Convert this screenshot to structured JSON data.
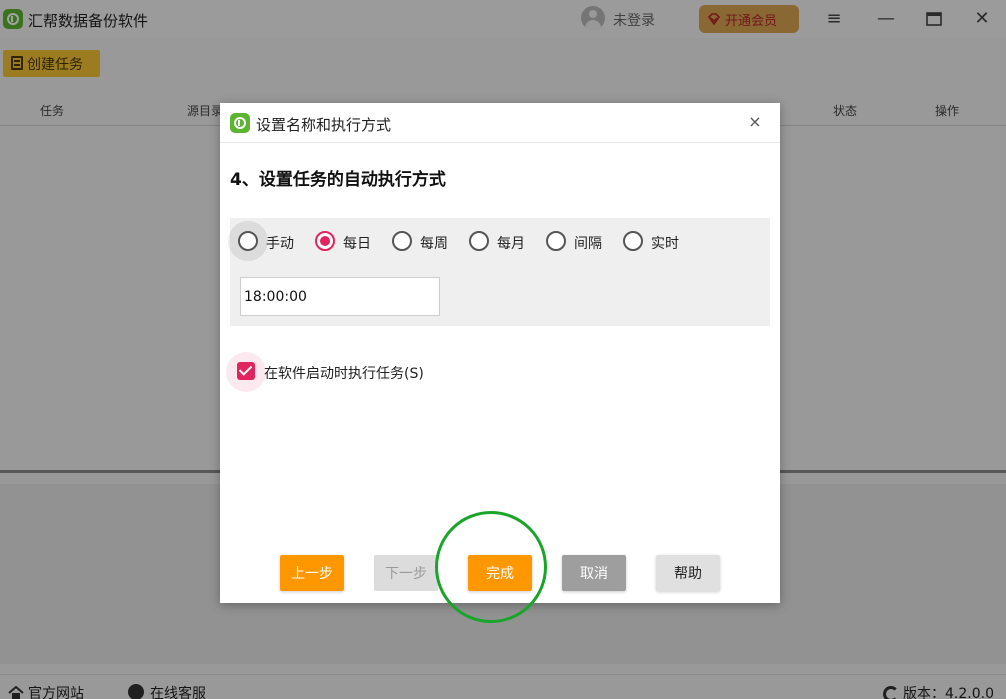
{
  "app": {
    "title": "汇帮数据备份软件",
    "login_text": "未登录",
    "vip_label": "开通会员",
    "create_task_label": "创建任务",
    "table_headers": {
      "task": "任务",
      "source": "源目录",
      "status": "状态",
      "actions": "操作"
    },
    "statusbar": {
      "official_site": "官方网站",
      "online_service": "在线客服",
      "version": "版本：4.2.0.0"
    }
  },
  "dialog": {
    "title": "设置名称和执行方式",
    "close_glyph": "×",
    "step_heading": "4、设置任务的自动执行方式",
    "schedule_options": [
      {
        "label": "手动",
        "checked": false
      },
      {
        "label": "每日",
        "checked": true
      },
      {
        "label": "每周",
        "checked": false
      },
      {
        "label": "每月",
        "checked": false
      },
      {
        "label": "间隔",
        "checked": false
      },
      {
        "label": "实时",
        "checked": false
      }
    ],
    "time_value": "18:00:00",
    "startup_checkbox_label": "在软件启动时执行任务(S)",
    "startup_checked": true,
    "buttons": {
      "prev": "上一步",
      "next": "下一步",
      "finish": "完成",
      "cancel": "取消",
      "help": "帮助"
    }
  },
  "colors": {
    "accent_orange": "#ff9800",
    "radio_checked": "#e0245e",
    "highlight_circle": "#1aa52a",
    "create_task_yellow": "#f2c232",
    "vip_gold": "#d8a352"
  }
}
